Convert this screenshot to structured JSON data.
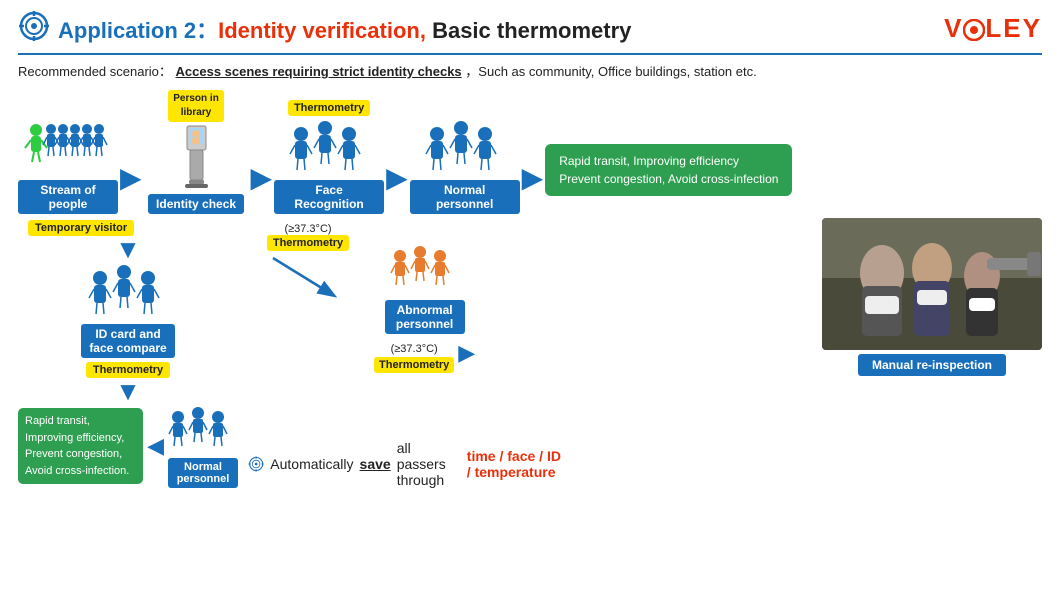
{
  "header": {
    "app_label": "Application 2：",
    "identity_text": "Identity verification,",
    "rest_title": " Basic thermometry",
    "logo": "VØLEY"
  },
  "scenario": {
    "prefix": "Recommended scenario：",
    "underline": "Access scenes requiring strict identity checks",
    "suffix": "，Such as community, Office buildings, station etc."
  },
  "top_flow": {
    "nodes": [
      {
        "id": "stream",
        "label": "Stream of people"
      },
      {
        "id": "identity",
        "label": "Identity check"
      },
      {
        "id": "face",
        "label": "Face Recognition",
        "tag": "Thermometry"
      },
      {
        "id": "normal",
        "label": "Normal personnel"
      }
    ],
    "result_green": "Rapid transit, Improving efficiency\nPrevent congestion, Avoid cross-infection"
  },
  "tags": {
    "person_in_library": "Person in\nlibrary",
    "thermometry": "Thermometry",
    "temporary_visitor": "Temporary visitor",
    "thermometry2": "Thermometry",
    "thermometry3": "Thermometry"
  },
  "bottom_flow": {
    "id_compare_label": "ID card and\nface compare",
    "abnormal_label": "Abnormal\npersonnel",
    "manual_label": "Manual re-inspection",
    "temp_threshold": "(≥37.3°C)",
    "temp_threshold2": "(≥37.3°C)",
    "normal_label2": "Normal personnel",
    "green_box": "Rapid transit,\nImproving efficiency,\nPrevent congestion,\nAvoid cross-infection."
  },
  "save_line": {
    "prefix": "Automatically ",
    "save_word": "save",
    "middle": " all passers through ",
    "highlights": "time / face / ID / temperature"
  }
}
